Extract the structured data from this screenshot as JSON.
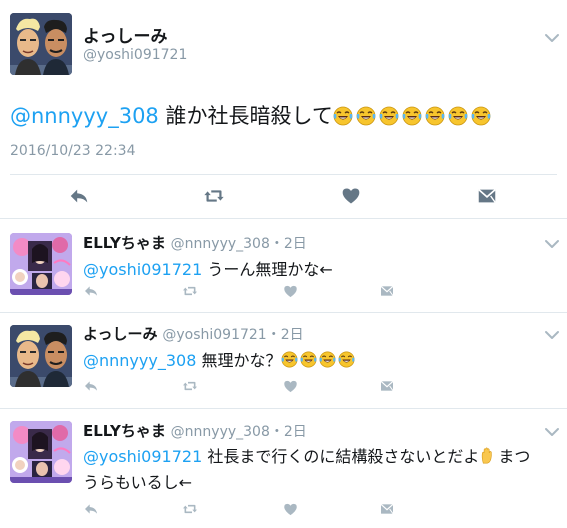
{
  "main_tweet": {
    "display_name": "よっしーみ",
    "handle": "@yoshi091721",
    "mention": "@nnnyyy_308",
    "text": " 誰か社長暗殺して",
    "emoji_name": "face-with-tears-of-joy",
    "emoji_count": 7,
    "timestamp": "2016/10/23 22:34"
  },
  "replies": [
    {
      "display_name": "ELLYちゃま",
      "handle_time": "@nnnyyy_308・2日",
      "mention": "@yoshi091721",
      "text": " うーん無理かな←",
      "avatar": "pink-collage-avatar"
    },
    {
      "display_name": "よっしーみ",
      "handle_time": "@yoshi091721・2日",
      "mention": "@nnnyyy_308",
      "text": " 無理かな？",
      "emoji_count": 4,
      "avatar": "cartoon-duo-avatar"
    },
    {
      "display_name": "ELLYちゃま",
      "handle_time": "@nnnyyy_308・2日",
      "mention": "@yoshi091721",
      "text_line1": " 社長まで行くのに結構殺さないとだよ",
      "text_line2": "まつ",
      "text_line3": "うらもいるし←",
      "inline_emoji": "raised-hand",
      "avatar": "pink-collage-avatar"
    }
  ],
  "icons": {
    "reply": "reply-icon",
    "retweet": "retweet-icon",
    "like": "heart-icon",
    "dm": "envelope-icon",
    "menu": "chevron-down-icon"
  },
  "colors": {
    "link": "#1da1f2",
    "muted": "#8899a6",
    "action_dark": "#657786",
    "action_light": "#aab8c2",
    "divider": "#e1e8ed"
  }
}
